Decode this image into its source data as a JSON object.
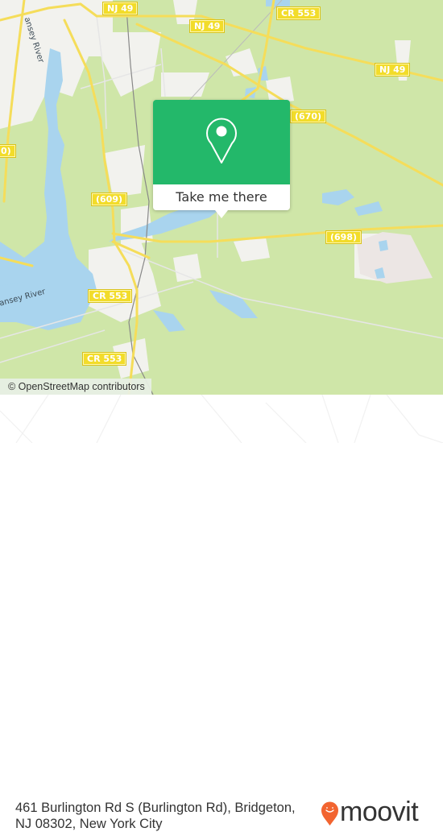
{
  "map": {
    "road_shields": [
      {
        "id": "nj49-a",
        "label": "NJ 49"
      },
      {
        "id": "nj49-b",
        "label": "NJ 49"
      },
      {
        "id": "nj49-c",
        "label": "NJ 49"
      },
      {
        "id": "cr553-a",
        "label": "CR 553"
      },
      {
        "id": "cr553-b",
        "label": "CR 553"
      },
      {
        "id": "cr553-c",
        "label": "CR 553"
      },
      {
        "id": "r670",
        "label": "(670)"
      },
      {
        "id": "r609",
        "label": "(609)"
      },
      {
        "id": "r698",
        "label": "(698)"
      },
      {
        "id": "r-left",
        "label": "0)"
      }
    ],
    "water_labels": [
      {
        "id": "river-top",
        "label": "ansey River"
      },
      {
        "id": "river-bottom",
        "label": "ansey River"
      }
    ],
    "attribution": "© OpenStreetMap contributors",
    "colors": {
      "land": "#cfe6a8",
      "water": "#a9d4ee",
      "urban": "#f2f2ee",
      "road": "#f5dd5a",
      "shield": "#f2dc2a"
    }
  },
  "popup": {
    "icon": "map-pin-icon",
    "button_label": "Take me there",
    "accent": "#23b86a"
  },
  "footer": {
    "address": "461 Burlington Rd S (Burlington Rd), Bridgeton, NJ 08302, New York City",
    "logo_text": "moovit",
    "logo_color": "#f26430"
  }
}
